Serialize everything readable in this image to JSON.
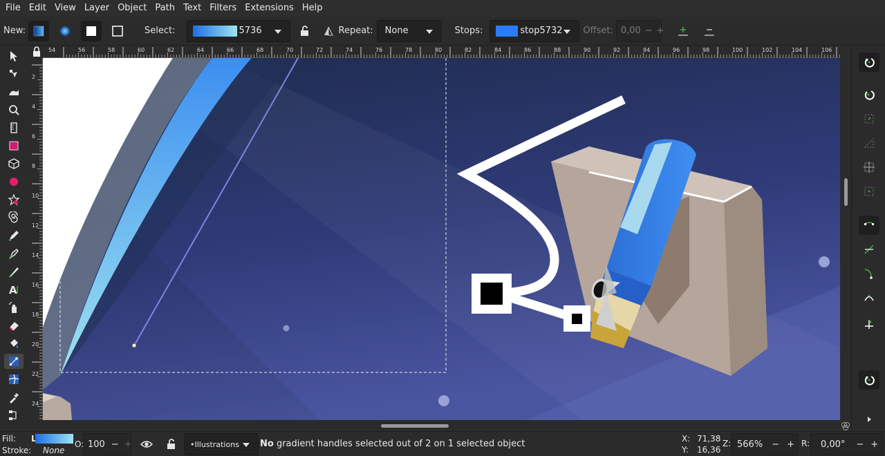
{
  "menu": [
    "File",
    "Edit",
    "View",
    "Layer",
    "Object",
    "Path",
    "Text",
    "Filters",
    "Extensions",
    "Help"
  ],
  "toolbar": {
    "new_label": "New:",
    "select_label": "Select:",
    "select_value": "5736",
    "repeat_label": "Repeat:",
    "repeat_value": "None",
    "stops_label": "Stops:",
    "stops_value": "stop5732",
    "offset_label": "Offset:",
    "offset_value": "0,00",
    "gradient_start": "#1d6fe6",
    "gradient_end": "#9ee4f0"
  },
  "ruler": {
    "top_ticks": [
      "54",
      "56",
      "58",
      "60",
      "62",
      "64",
      "66",
      "68",
      "70",
      "72",
      "74",
      "76",
      "78",
      "80",
      "82",
      "84",
      "86",
      "88",
      "90",
      "92",
      "94",
      "96",
      "98",
      "100",
      "102",
      "104",
      "106"
    ],
    "left_ticks": [
      "2",
      "4",
      "6",
      "8",
      "10",
      "12",
      "14",
      "16",
      "18",
      "20",
      "22",
      "24"
    ]
  },
  "status": {
    "fill_label": "Fill:",
    "fill_value": "L",
    "stroke_label": "Stroke:",
    "stroke_value": "None",
    "opacity_label": "O:",
    "opacity_value": "100",
    "layer_value": "•Illustrations",
    "message_bold": "No",
    "message_rest": " gradient handles selected out of 2 on 1 selected object",
    "x_label": "X:",
    "x_value": "71,38",
    "y_label": "Y:",
    "y_value": "16,36",
    "zoom_label": "Z:",
    "zoom_value": "566%",
    "rotation_label": "R:",
    "rotation_value": "0,00°"
  },
  "colors": {
    "canvas_dark": "#1f2d4f",
    "canvas_light": "#4a55a0",
    "accent_blue": "#3d8ef0"
  },
  "icons": {
    "tools": [
      "selector-icon",
      "node-icon",
      "tweak-icon",
      "zoom-icon",
      "measure-icon",
      "rectangle-icon",
      "box3d-icon",
      "ellipse-icon",
      "star-icon",
      "spiral-icon",
      "pencil-icon",
      "pen-icon",
      "calligraphy-icon",
      "text-icon",
      "spray-icon",
      "eraser-icon",
      "bucket-icon",
      "gradient-icon",
      "mesh-icon",
      "dropper-icon",
      "connector-icon"
    ],
    "commands": [
      "snap-toggle-icon",
      "snap-enable-icon",
      "snap-bbox-icon",
      "snap-bbox-edge-icon",
      "snap-bbox-corner-icon",
      "snap-bbox-midpoint-icon",
      "snap-nodes-icon",
      "snap-path-icon",
      "snap-intersection-icon",
      "snap-smooth-icon",
      "snap-line-midpoint-icon",
      "snap-rotation-center-icon",
      "snap-page-icon",
      "more-icon"
    ]
  }
}
